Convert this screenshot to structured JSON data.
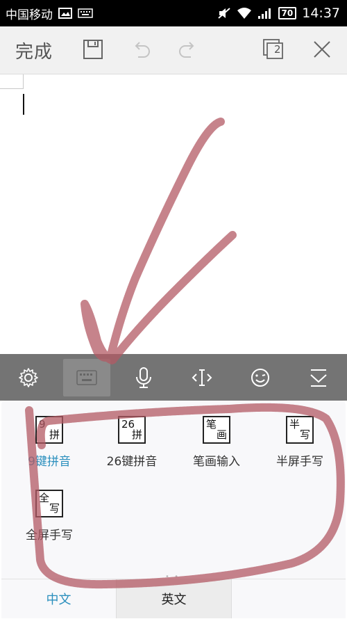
{
  "status_bar": {
    "carrier": "中国移动",
    "battery": "70",
    "time": "14:37"
  },
  "toolbar": {
    "done_label": "完成",
    "page_count": "2"
  },
  "input_methods": [
    {
      "id": "nine-key",
      "glyph_top": "9",
      "glyph_bottom": "拼",
      "label": "9键拼音",
      "selected": true
    },
    {
      "id": "qwerty",
      "glyph_top": "26",
      "glyph_bottom": "拼",
      "label": "26键拼音",
      "selected": false
    },
    {
      "id": "stroke",
      "glyph_top": "笔",
      "glyph_bottom": "画",
      "label": "笔画输入",
      "selected": false
    },
    {
      "id": "half-hw",
      "glyph_top": "半",
      "glyph_bottom": "写",
      "label": "半屏手写",
      "selected": false
    },
    {
      "id": "full-hw",
      "glyph_top": "全",
      "glyph_bottom": "写",
      "label": "全屏手写",
      "selected": false
    }
  ],
  "tabs": {
    "chinese": "中文",
    "english": "英文"
  },
  "colors": {
    "accent": "#2a8fbd",
    "scribble": "#b35a64"
  }
}
